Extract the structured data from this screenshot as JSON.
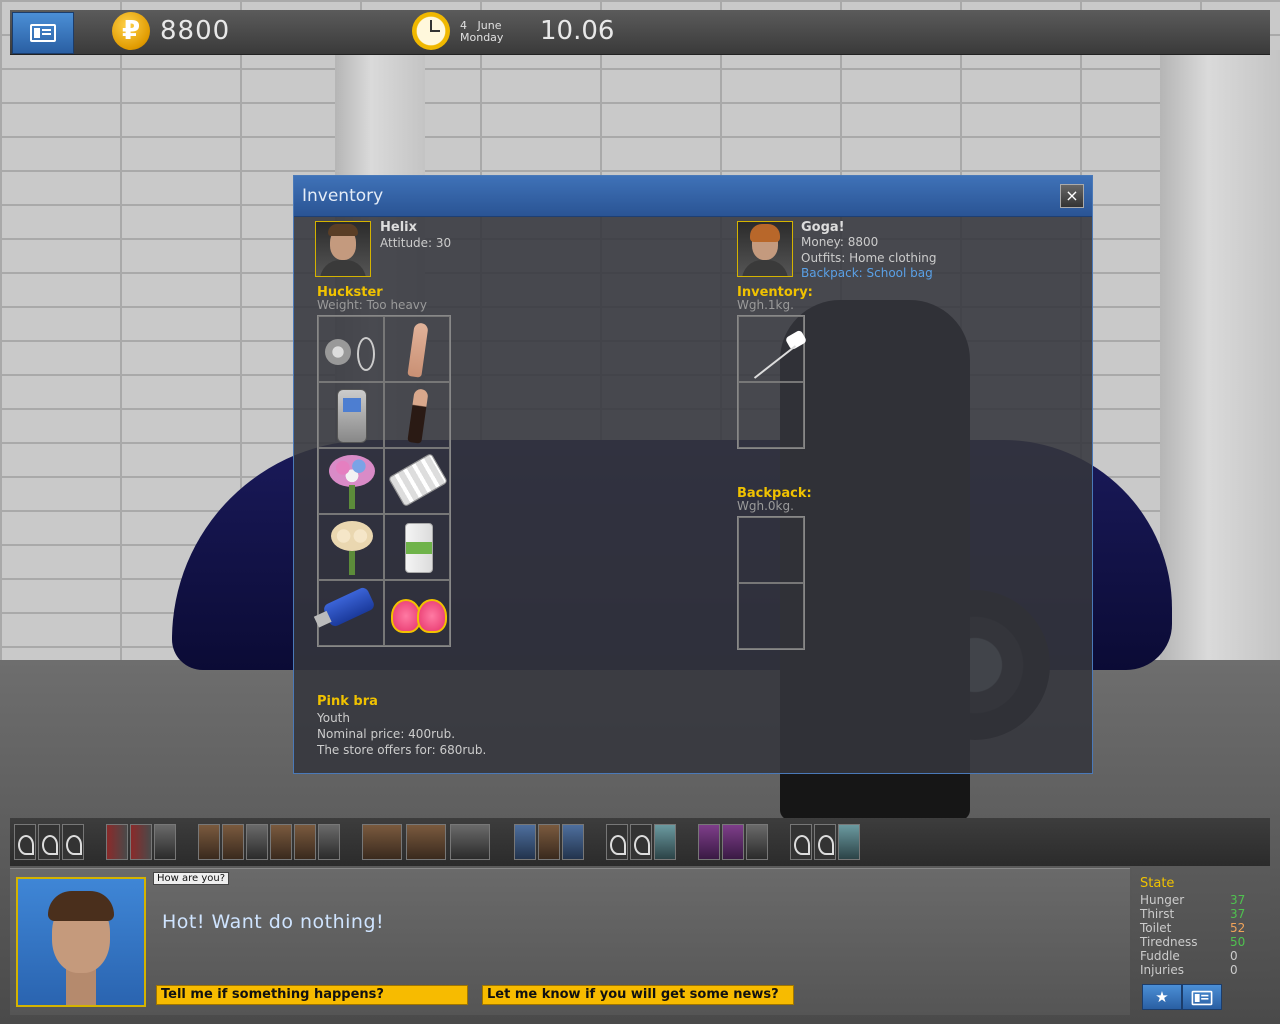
{
  "topbar": {
    "money": "8800",
    "coin_symbol": "₽",
    "date_day": "4",
    "date_month": "June",
    "date_weekday": "Monday",
    "time": "10.06"
  },
  "inventory": {
    "title": "Inventory",
    "close_symbol": "×",
    "npc": {
      "name": "Helix",
      "attitude": "Attitude: 30",
      "shop_label": "Huckster",
      "weight": "Weight: Too heavy",
      "items": [
        "earrings-set-icon",
        "stockings-icon",
        "mobile-phone-icon",
        "dark-stockings-icon",
        "flower-bouquet-icon",
        "pills-icon",
        "roses-icon",
        "vitamin-bottle-icon",
        "usb-flash-drive-icon",
        "pink-bra-icon"
      ]
    },
    "player": {
      "name": "Goga!",
      "money": "Money: 8800",
      "outfits": "Outfits: Home clothing",
      "backpack_link": "Backpack: School bag",
      "inventory_label": "Inventory:",
      "inventory_weight": "Wgh.1kg.",
      "backpack_label": "Backpack:",
      "backpack_weight": "Wgh.0kg."
    },
    "selected_item": {
      "title": "Pink bra",
      "category": "Youth",
      "nominal": "Nominal price: 400rub.",
      "offer": "The store offers for: 680rub."
    }
  },
  "dialog": {
    "small_bubble": "How are you?",
    "text": "Hot! Want do nothing!",
    "choice_1": "Tell me if something happens?",
    "choice_2": "Let me know if you will get some news?"
  },
  "state": {
    "title": "State",
    "rows": [
      {
        "label": "Hunger",
        "value": "37",
        "color": "#4fc24f"
      },
      {
        "label": "Thirst",
        "value": "37",
        "color": "#4fc24f"
      },
      {
        "label": "Toilet",
        "value": "52",
        "color": "#f0a35a"
      },
      {
        "label": "Tiredness",
        "value": "50",
        "color": "#4fc24f"
      },
      {
        "label": "Fuddle",
        "value": "0",
        "color": "#cccccc"
      },
      {
        "label": "Injuries",
        "value": "0",
        "color": "#cccccc"
      }
    ],
    "star_symbol": "★"
  }
}
